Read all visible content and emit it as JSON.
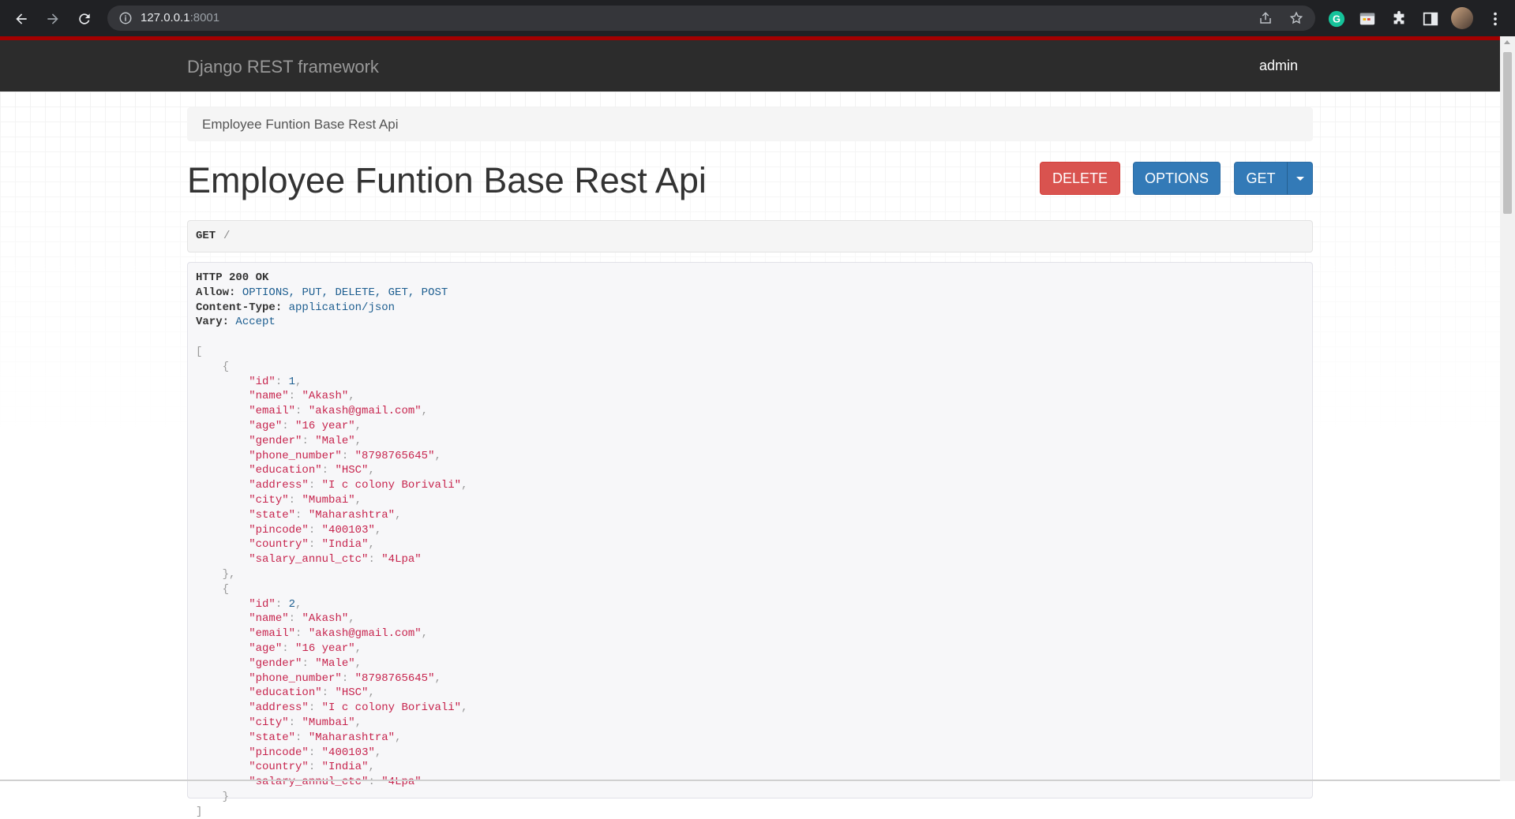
{
  "browser": {
    "url_host": "127.0.0.1",
    "url_port": ":8001"
  },
  "navbar": {
    "brand": "Django REST framework",
    "user": "admin"
  },
  "breadcrumb": "Employee Funtion Base Rest Api",
  "page_title": "Employee Funtion Base Rest Api",
  "buttons": {
    "delete": "DELETE",
    "options": "OPTIONS",
    "get": "GET"
  },
  "request": {
    "method": "GET",
    "path": "/"
  },
  "response": {
    "status": "HTTP 200 OK",
    "headers": [
      {
        "key": "Allow:",
        "value": "OPTIONS, PUT, DELETE, GET, POST"
      },
      {
        "key": "Content-Type:",
        "value": "application/json"
      },
      {
        "key": "Vary:",
        "value": "Accept"
      }
    ],
    "records": [
      {
        "id": 1,
        "name": "Akash",
        "email": "akash@gmail.com",
        "age": "16 year",
        "gender": "Male",
        "phone_number": "8798765645",
        "education": "HSC",
        "address": "I c colony Borivali",
        "city": "Mumbai",
        "state": "Maharashtra",
        "pincode": "400103",
        "country": "India",
        "salary_annul_ctc": "4Lpa"
      },
      {
        "id": 2,
        "name": "Akash",
        "email": "akash@gmail.com",
        "age": "16 year",
        "gender": "Male",
        "phone_number": "8798765645",
        "education": "HSC",
        "address": "I c colony Borivali",
        "city": "Mumbai",
        "state": "Maharashtra",
        "pincode": "400103",
        "country": "India",
        "salary_annul_ctc": "4Lpa"
      }
    ]
  }
}
